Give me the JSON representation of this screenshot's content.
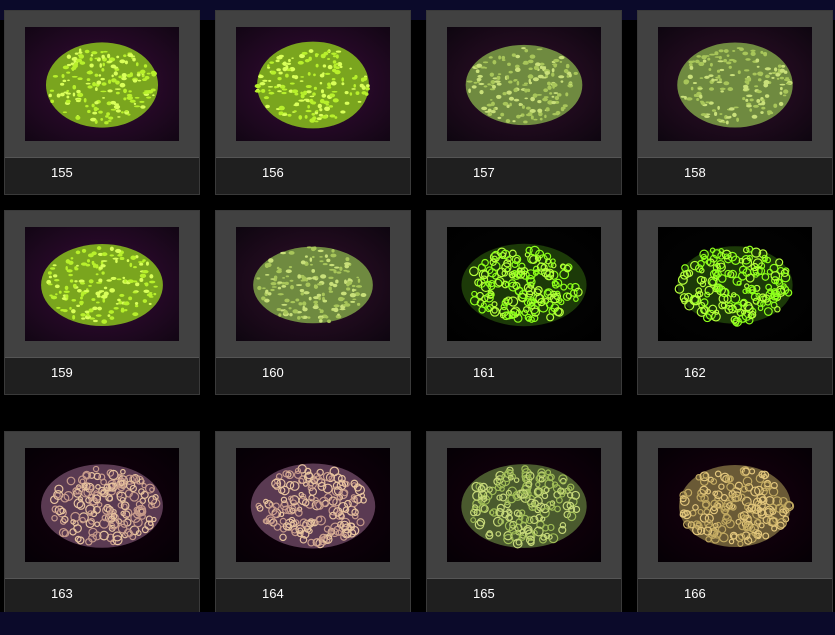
{
  "colors": {
    "page_bg": "#000000",
    "bar_bg": "#0b0a2a",
    "frame": "#414141",
    "card": "#1f1f1f"
  },
  "gallery": {
    "items": [
      {
        "number": "155",
        "style": "lime-fuzzy"
      },
      {
        "number": "156",
        "style": "lime-fuzzy"
      },
      {
        "number": "157",
        "style": "olive-fuzzy"
      },
      {
        "number": "158",
        "style": "olive-fuzzy"
      },
      {
        "number": "159",
        "style": "lime-fuzzy"
      },
      {
        "number": "160",
        "style": "olive-fuzzy"
      },
      {
        "number": "161",
        "style": "neon-ring"
      },
      {
        "number": "162",
        "style": "neon-ring"
      },
      {
        "number": "163",
        "style": "pink-brain"
      },
      {
        "number": "164",
        "style": "pink-brain"
      },
      {
        "number": "165",
        "style": "green-brain"
      },
      {
        "number": "166",
        "style": "tan-brain"
      }
    ]
  }
}
